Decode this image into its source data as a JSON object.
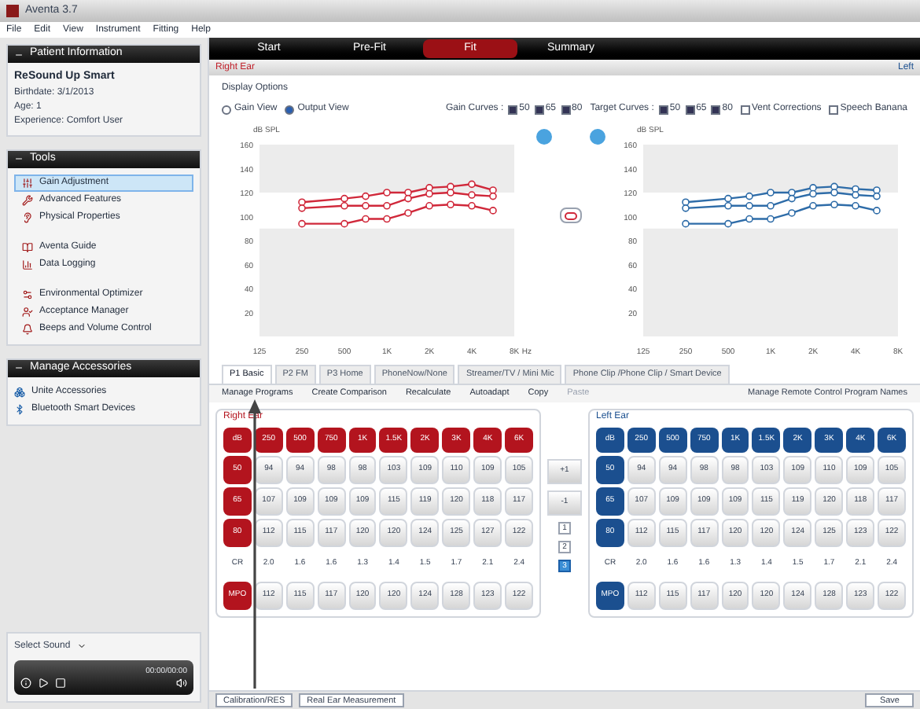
{
  "window": {
    "title": "Aventa 3.7"
  },
  "menu": [
    "File",
    "Edit",
    "View",
    "Instrument",
    "Fitting",
    "Help"
  ],
  "patient": {
    "title": "Patient Information",
    "name": "ReSound Up Smart",
    "lines": [
      "Birthdate: 3/1/2013",
      "Age: 1",
      "Experience: Comfort User"
    ]
  },
  "tools": {
    "title": "Tools",
    "groups": [
      [
        {
          "label": "Gain Adjustment",
          "selected": true,
          "kind": "gain"
        },
        {
          "label": "Advanced Features",
          "selected": false,
          "kind": "features"
        },
        {
          "label": "Physical Properties",
          "selected": false,
          "kind": "physical"
        }
      ],
      [
        {
          "label": "Aventa Guide",
          "selected": false,
          "kind": "guide"
        },
        {
          "label": "Data Logging",
          "selected": false,
          "kind": "logging"
        }
      ],
      [
        {
          "label": "Environmental Optimizer",
          "selected": false,
          "kind": "optimizer"
        },
        {
          "label": "Acceptance Manager",
          "selected": false,
          "kind": "acceptance"
        },
        {
          "label": "Beeps and Volume Control",
          "selected": false,
          "kind": "volume"
        }
      ]
    ]
  },
  "accessories": {
    "title": "Manage Accessories",
    "items": [
      {
        "label": "Unite Accessories",
        "kind": "unite"
      },
      {
        "label": "Bluetooth Smart Devices",
        "kind": "bluetooth"
      }
    ]
  },
  "sound_player": {
    "title": "Select Sound",
    "time": "00:00/00:00"
  },
  "nav_tabs": [
    {
      "label": "Start",
      "selected": false
    },
    {
      "label": "Pre-Fit",
      "selected": false
    },
    {
      "label": "Fit",
      "selected": true
    },
    {
      "label": "Summary",
      "selected": false
    }
  ],
  "ear_bar": {
    "right": "Right Ear",
    "left": "Left"
  },
  "display_options": {
    "title": "Display Options",
    "views": [
      {
        "label": "Gain View",
        "selected": false
      },
      {
        "label": "Output View",
        "selected": true
      }
    ],
    "gain_curves": {
      "label": "Gain Curves :",
      "options": [
        {
          "label": "50",
          "checked": true
        },
        {
          "label": "65",
          "checked": true
        },
        {
          "label": "80",
          "checked": true
        }
      ]
    },
    "target_curves": {
      "label": "Target Curves :",
      "options": [
        {
          "label": "50",
          "checked": true
        },
        {
          "label": "65",
          "checked": true
        },
        {
          "label": "80",
          "checked": true
        }
      ]
    },
    "extras": [
      {
        "label": "Vent Corrections",
        "checked": false
      },
      {
        "label": "Speech Banana",
        "checked": false
      }
    ]
  },
  "charts": [
    {
      "chart_data": {
        "type": "line",
        "ylabel": "dB SPL",
        "xlabel": "Hz",
        "categories": [
          "125",
          null,
          "250",
          null,
          "500",
          null,
          "1K",
          null,
          "2K",
          null,
          "4K",
          null,
          "8K"
        ],
        "ylim": [
          0,
          160
        ],
        "yticks": [
          20,
          40,
          60,
          80,
          100,
          120,
          140,
          160
        ],
        "bands": [
          {
            "axis": "y",
            "from": 90,
            "to": 120,
            "color": "#ffffff"
          }
        ],
        "series": [
          {
            "color": "#d0283a",
            "marker": "circle",
            "values": [
              null,
              null,
              112,
              null,
              115,
              117,
              120,
              120,
              124,
              125,
              127,
              122,
              null
            ]
          },
          {
            "color": "#d0283a",
            "marker": "circle",
            "values": [
              null,
              null,
              107,
              null,
              109,
              109,
              109,
              115,
              119,
              120,
              118,
              117,
              null
            ]
          },
          {
            "color": "#d0283a",
            "marker": "circle",
            "values": [
              null,
              null,
              94,
              null,
              94,
              98,
              98,
              103,
              109,
              110,
              109,
              105,
              null
            ]
          }
        ]
      }
    },
    {
      "chart_data": {
        "type": "line",
        "ylabel": "dB SPL",
        "categories": [
          "125",
          null,
          "250",
          null,
          "500",
          null,
          "1K",
          null,
          "2K",
          null,
          "4K",
          null,
          "8K"
        ],
        "ylim": [
          0,
          160
        ],
        "yticks": [
          20,
          40,
          60,
          80,
          100,
          120,
          140,
          160
        ],
        "bands": [
          {
            "axis": "y",
            "from": 90,
            "to": 120,
            "color": "#ffffff"
          }
        ],
        "series": [
          {
            "color": "#2e6ca8",
            "marker": "circle",
            "values": [
              null,
              null,
              112,
              null,
              115,
              117,
              120,
              120,
              124,
              125,
              123,
              122,
              null
            ]
          },
          {
            "color": "#2e6ca8",
            "marker": "circle",
            "values": [
              null,
              null,
              107,
              null,
              109,
              109,
              109,
              115,
              119,
              120,
              118,
              117,
              null
            ]
          },
          {
            "color": "#2e6ca8",
            "marker": "circle",
            "values": [
              null,
              null,
              94,
              null,
              94,
              98,
              98,
              103,
              109,
              110,
              109,
              105,
              null
            ]
          }
        ]
      }
    }
  ],
  "program_tabs": [
    {
      "label": "P1 Basic",
      "selected": true
    },
    {
      "label": "P2 FM",
      "selected": false
    },
    {
      "label": "P3 Home",
      "selected": false
    },
    {
      "label": "PhoneNow/None",
      "selected": false
    },
    {
      "label": "Streamer/TV / Mini Mic",
      "selected": false
    },
    {
      "label": "Phone Clip /Phone Clip / Smart Device",
      "selected": false
    }
  ],
  "toolbar": [
    {
      "label": "Manage Programs",
      "disabled": false
    },
    {
      "label": "Create Comparison",
      "disabled": false
    },
    {
      "label": "Recalculate",
      "disabled": false
    },
    {
      "label": "Autoadapt",
      "disabled": false
    },
    {
      "label": "Copy",
      "disabled": false
    },
    {
      "label": "Paste",
      "disabled": true
    }
  ],
  "toolbar_right": "Manage Remote Control Program Names",
  "ears": [
    {
      "color": "#b3141e",
      "title": "Right Ear",
      "headers": [
        "dB",
        "250",
        "500",
        "750",
        "1K",
        "1.5K",
        "2K",
        "3K",
        "4K",
        "6K"
      ],
      "rows": [
        {
          "label": "50",
          "kind": "button",
          "values": [
            "94",
            "94",
            "98",
            "98",
            "103",
            "109",
            "110",
            "109",
            "105"
          ]
        },
        {
          "label": "65",
          "kind": "button",
          "values": [
            "107",
            "109",
            "109",
            "109",
            "115",
            "119",
            "120",
            "118",
            "117"
          ]
        },
        {
          "label": "80",
          "kind": "button",
          "values": [
            "112",
            "115",
            "117",
            "120",
            "120",
            "124",
            "125",
            "127",
            "122"
          ]
        },
        {
          "label": "CR",
          "kind": "text",
          "values": [
            "2.0",
            "1.6",
            "1.6",
            "1.3",
            "1.4",
            "1.5",
            "1.7",
            "2.1",
            "2.4"
          ]
        },
        {
          "label": "MPO",
          "kind": "button",
          "values": [
            "112",
            "115",
            "117",
            "120",
            "120",
            "124",
            "128",
            "123",
            "122"
          ]
        }
      ]
    },
    {
      "color": "#1b4f8f",
      "title": "Left Ear",
      "headers": [
        "dB",
        "250",
        "500",
        "750",
        "1K",
        "1.5K",
        "2K",
        "3K",
        "4K",
        "6K"
      ],
      "rows": [
        {
          "label": "50",
          "kind": "button",
          "values": [
            "94",
            "94",
            "98",
            "98",
            "103",
            "109",
            "110",
            "109",
            "105"
          ]
        },
        {
          "label": "65",
          "kind": "button",
          "values": [
            "107",
            "109",
            "109",
            "109",
            "115",
            "119",
            "120",
            "118",
            "117"
          ]
        },
        {
          "label": "80",
          "kind": "button",
          "values": [
            "112",
            "115",
            "117",
            "120",
            "120",
            "124",
            "125",
            "123",
            "122"
          ]
        },
        {
          "label": "CR",
          "kind": "text",
          "values": [
            "2.0",
            "1.6",
            "1.6",
            "1.3",
            "1.4",
            "1.5",
            "1.7",
            "2.1",
            "2.4"
          ]
        },
        {
          "label": "MPO",
          "kind": "button",
          "values": [
            "112",
            "115",
            "117",
            "120",
            "120",
            "124",
            "128",
            "123",
            "122"
          ]
        }
      ]
    }
  ],
  "steps": {
    "up": "+1",
    "down": "-1",
    "levels": [
      {
        "label": "1",
        "selected": false
      },
      {
        "label": "2",
        "selected": false
      },
      {
        "label": "3",
        "selected": true
      }
    ]
  },
  "bottom": {
    "buttons": [
      "Calibration/RES",
      "Real Ear Measurement"
    ],
    "save": "Save"
  }
}
